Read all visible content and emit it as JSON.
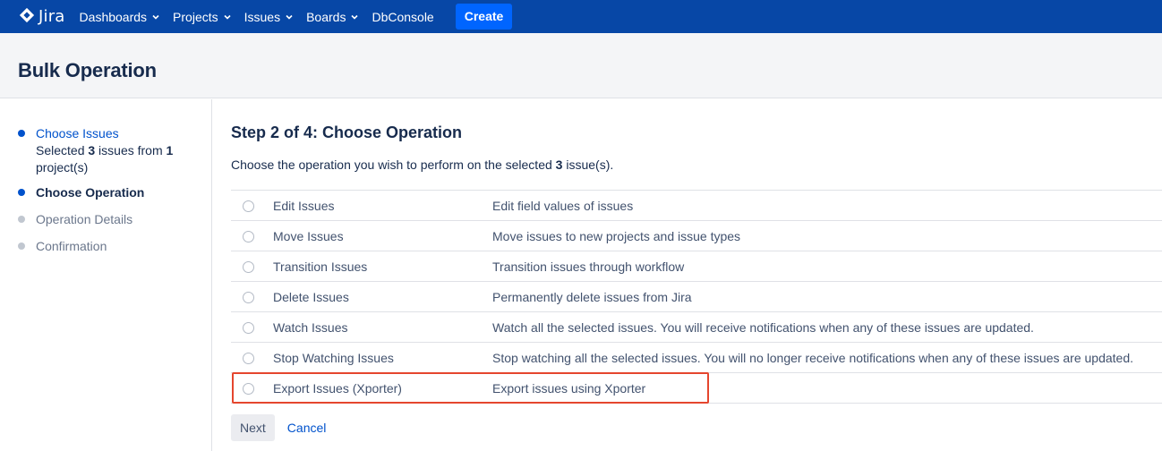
{
  "nav": {
    "logo_text": "Jira",
    "logo_icon": "jira-logo-icon",
    "items": [
      {
        "label": "Dashboards",
        "has_chevron": true
      },
      {
        "label": "Projects",
        "has_chevron": true
      },
      {
        "label": "Issues",
        "has_chevron": true
      },
      {
        "label": "Boards",
        "has_chevron": true
      },
      {
        "label": "DbConsole",
        "has_chevron": false
      }
    ],
    "create_label": "Create"
  },
  "header": {
    "title": "Bulk Operation"
  },
  "sidebar": {
    "steps": [
      {
        "label": "Choose Issues",
        "state": "done"
      },
      {
        "label": "Choose Operation",
        "state": "current"
      },
      {
        "label": "Operation Details",
        "state": "future"
      },
      {
        "label": "Confirmation",
        "state": "future"
      }
    ],
    "summary": {
      "prefix": "Selected ",
      "issue_count": "3",
      "middle": " issues from ",
      "project_count": "1",
      "suffix": "project(s)"
    }
  },
  "main": {
    "title": "Step 2 of 4: Choose Operation",
    "desc_prefix": "Choose the operation you wish to perform on the selected ",
    "desc_count": "3",
    "desc_suffix": " issue(s).",
    "operations": [
      {
        "name": "Edit Issues",
        "desc": "Edit field values of issues"
      },
      {
        "name": "Move Issues",
        "desc": "Move issues to new projects and issue types"
      },
      {
        "name": "Transition Issues",
        "desc": "Transition issues through workflow"
      },
      {
        "name": "Delete Issues",
        "desc": "Permanently delete issues from Jira"
      },
      {
        "name": "Watch Issues",
        "desc": "Watch all the selected issues. You will receive notifications when any of these issues are updated."
      },
      {
        "name": "Stop Watching Issues",
        "desc": "Stop watching all the selected issues. You will no longer receive notifications when any of these issues are updated."
      },
      {
        "name": "Export Issues (Xporter)",
        "desc": "Export issues using Xporter"
      }
    ],
    "highlighted_operation": "Export Issues (Xporter)",
    "next_label": "Next",
    "cancel_label": "Cancel"
  },
  "colors": {
    "nav_bg": "#0747a6",
    "create_bg": "#0065ff",
    "link": "#0052cc",
    "highlight_border": "#e5462e",
    "header_bg": "#f4f5f7"
  }
}
